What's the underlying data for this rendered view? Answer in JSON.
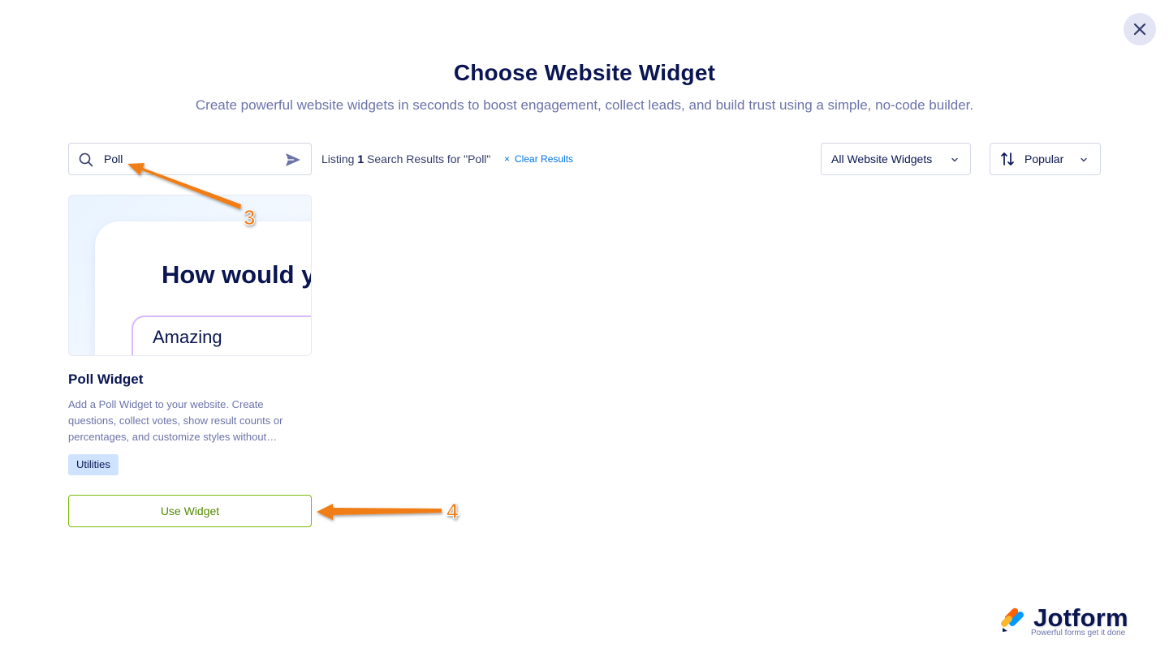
{
  "header": {
    "title": "Choose Website Widget",
    "subtitle": "Create powerful website widgets in seconds to boost engagement, collect leads, and build trust using a simple, no-code builder."
  },
  "search": {
    "value": "Poll",
    "listing_prefix": "Listing",
    "count": "1",
    "listing_suffix": "Search Results for \"Poll\"",
    "clear_label": "Clear Results"
  },
  "filters": {
    "type_selected": "All Website Widgets",
    "sort_selected": "Popular"
  },
  "widget": {
    "preview_question": "How would y",
    "preview_option": "Amazing",
    "title": "Poll Widget",
    "description": "Add a Poll Widget to your website. Create questions, collect votes, show result counts or percentages, and customize styles without…",
    "tag": "Utilities",
    "button_label": "Use Widget"
  },
  "annotations": {
    "step_a": "3",
    "step_b": "4",
    "color": "#f07d12"
  },
  "brand": {
    "name": "Jotform",
    "tagline": "Powerful forms get it done"
  },
  "icons": {
    "close": "close-icon",
    "search": "search-icon",
    "send": "send-icon",
    "chevron": "chevron-down-icon",
    "sort": "sort-icon"
  }
}
